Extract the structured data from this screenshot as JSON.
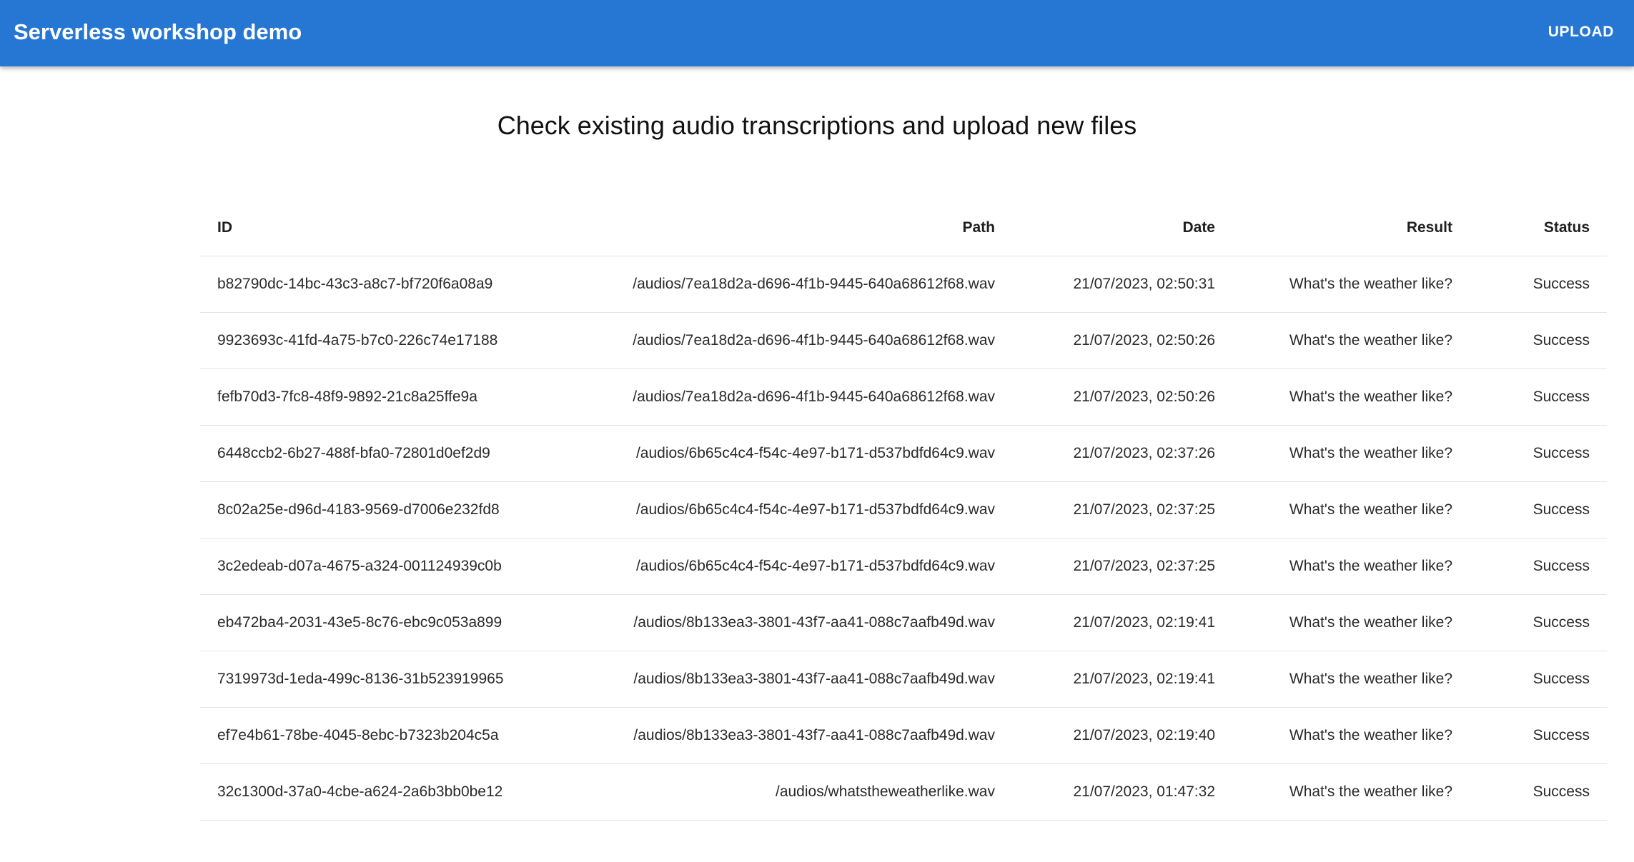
{
  "header": {
    "title": "Serverless workshop demo",
    "upload_label": "UPLOAD"
  },
  "main": {
    "heading": "Check existing audio transcriptions and upload new files"
  },
  "table": {
    "columns": {
      "id": "ID",
      "path": "Path",
      "date": "Date",
      "result": "Result",
      "status": "Status"
    },
    "rows": [
      {
        "id": "b82790dc-14bc-43c3-a8c7-bf720f6a08a9",
        "path": "/audios/7ea18d2a-d696-4f1b-9445-640a68612f68.wav",
        "date": "21/07/2023, 02:50:31",
        "result": "What's the weather like?",
        "status": "Success"
      },
      {
        "id": "9923693c-41fd-4a75-b7c0-226c74e17188",
        "path": "/audios/7ea18d2a-d696-4f1b-9445-640a68612f68.wav",
        "date": "21/07/2023, 02:50:26",
        "result": "What's the weather like?",
        "status": "Success"
      },
      {
        "id": "fefb70d3-7fc8-48f9-9892-21c8a25ffe9a",
        "path": "/audios/7ea18d2a-d696-4f1b-9445-640a68612f68.wav",
        "date": "21/07/2023, 02:50:26",
        "result": "What's the weather like?",
        "status": "Success"
      },
      {
        "id": "6448ccb2-6b27-488f-bfa0-72801d0ef2d9",
        "path": "/audios/6b65c4c4-f54c-4e97-b171-d537bdfd64c9.wav",
        "date": "21/07/2023, 02:37:26",
        "result": "What's the weather like?",
        "status": "Success"
      },
      {
        "id": "8c02a25e-d96d-4183-9569-d7006e232fd8",
        "path": "/audios/6b65c4c4-f54c-4e97-b171-d537bdfd64c9.wav",
        "date": "21/07/2023, 02:37:25",
        "result": "What's the weather like?",
        "status": "Success"
      },
      {
        "id": "3c2edeab-d07a-4675-a324-001124939c0b",
        "path": "/audios/6b65c4c4-f54c-4e97-b171-d537bdfd64c9.wav",
        "date": "21/07/2023, 02:37:25",
        "result": "What's the weather like?",
        "status": "Success"
      },
      {
        "id": "eb472ba4-2031-43e5-8c76-ebc9c053a899",
        "path": "/audios/8b133ea3-3801-43f7-aa41-088c7aafb49d.wav",
        "date": "21/07/2023, 02:19:41",
        "result": "What's the weather like?",
        "status": "Success"
      },
      {
        "id": "7319973d-1eda-499c-8136-31b523919965",
        "path": "/audios/8b133ea3-3801-43f7-aa41-088c7aafb49d.wav",
        "date": "21/07/2023, 02:19:41",
        "result": "What's the weather like?",
        "status": "Success"
      },
      {
        "id": "ef7e4b61-78be-4045-8ebc-b7323b204c5a",
        "path": "/audios/8b133ea3-3801-43f7-aa41-088c7aafb49d.wav",
        "date": "21/07/2023, 02:19:40",
        "result": "What's the weather like?",
        "status": "Success"
      },
      {
        "id": "32c1300d-37a0-4cbe-a624-2a6b3bb0be12",
        "path": "/audios/whatstheweatherlike.wav",
        "date": "21/07/2023, 01:47:32",
        "result": "What's the weather like?",
        "status": "Success"
      }
    ]
  },
  "colors": {
    "app_bar": "#2677d3",
    "app_bar_text": "#ffffff",
    "divider": "#e3e3e3"
  }
}
